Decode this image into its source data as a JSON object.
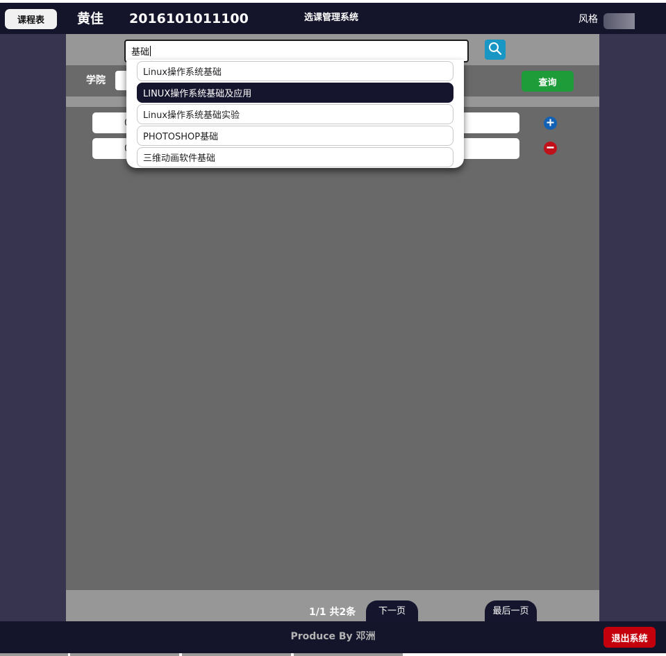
{
  "header": {
    "schedule_button": "课程表",
    "user_name": "黄佳",
    "user_id": "2016101011100",
    "system_title": "选课管理系统",
    "style_label": "风格"
  },
  "search": {
    "value": "基础",
    "button_icon": "search-icon"
  },
  "filter": {
    "college_label": "学院",
    "query_button": "查询"
  },
  "results": {
    "rows": [
      {
        "text": "0",
        "action": "add"
      },
      {
        "text": "0",
        "action": "remove"
      }
    ],
    "add_icon": "plus-circle-icon",
    "remove_icon": "minus-circle-icon"
  },
  "suggestions": {
    "items": [
      "Linux操作系统基础",
      "LINUX操作系统基础及应用",
      "Linux操作系统基础实验",
      "PHOTOSHOP基础",
      "三维动画软件基础"
    ],
    "highlighted_index": 1
  },
  "pagination": {
    "info": "1/1 共2条",
    "next_button": "下一页",
    "last_button": "最后一页"
  },
  "footer": {
    "credit": "Produce By 邓洲",
    "logout_button": "退出系统"
  },
  "colors": {
    "header_bg": "#14142b",
    "side_bg": "#373450",
    "panel_gray": "#979797",
    "content_gray": "#696969",
    "search_button": "#1896c4",
    "query_button": "#1e9c3a",
    "logout_button": "#c3000b",
    "highlight": "#15152d"
  }
}
